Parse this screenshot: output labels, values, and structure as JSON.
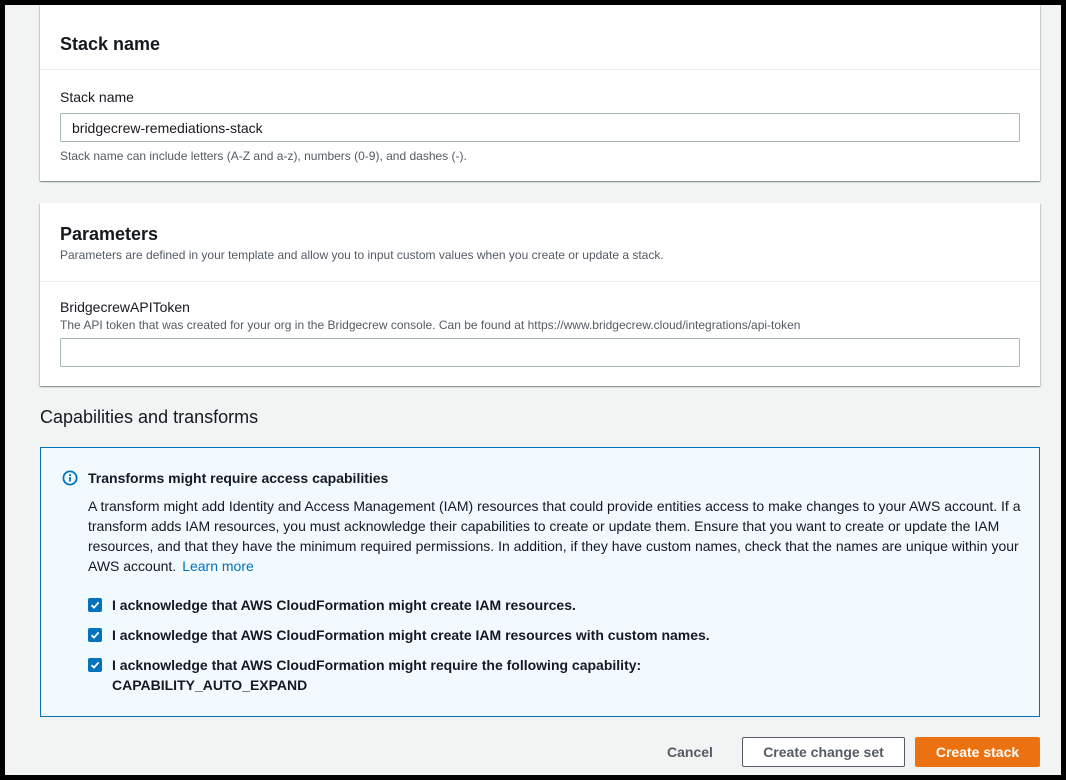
{
  "stack_panel": {
    "title": "Stack name",
    "field_label": "Stack name",
    "field_value": "bridgecrew-remediations-stack",
    "field_hint": "Stack name can include letters (A-Z and a-z), numbers (0-9), and dashes (-)."
  },
  "parameters_panel": {
    "title": "Parameters",
    "description": "Parameters are defined in your template and allow you to input custom values when you create or update a stack.",
    "field_label": "BridgecrewAPIToken",
    "field_desc": "The API token that was created for your org in the Bridgecrew console. Can be found at https://www.bridgecrew.cloud/integrations/api-token",
    "field_value": ""
  },
  "capabilities": {
    "section_title": "Capabilities and transforms",
    "alert_icon": "info-icon",
    "alert_title": "Transforms might require access capabilities",
    "alert_body": "A transform might add Identity and Access Management (IAM) resources that could provide entities access to make changes to your AWS account. If a transform adds IAM resources, you must acknowledge their capabilities to create or update them. Ensure that you want to create or update the IAM resources, and that they have the minimum required permissions. In addition, if they have custom names, check that the names are unique within your AWS account.",
    "learn_more": "Learn more",
    "checks": [
      {
        "label": "I acknowledge that AWS CloudFormation might create IAM resources.",
        "checked": true
      },
      {
        "label": "I acknowledge that AWS CloudFormation might create IAM resources with custom names.",
        "checked": true
      },
      {
        "label": "I acknowledge that AWS CloudFormation might require the following capability:",
        "label_line2": "CAPABILITY_AUTO_EXPAND",
        "checked": true
      }
    ]
  },
  "actions": {
    "cancel": "Cancel",
    "create_change_set": "Create change set",
    "create_stack": "Create stack"
  },
  "colors": {
    "primary": "#ec7211",
    "link": "#0073bb",
    "alert_bg": "#f1faff",
    "page_bg": "#f2f3f3"
  }
}
